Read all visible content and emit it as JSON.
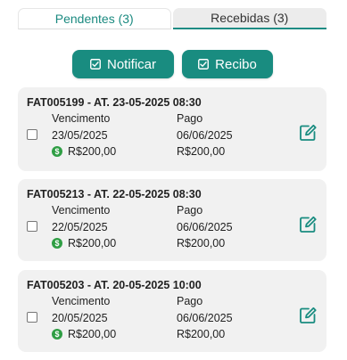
{
  "tabs": {
    "pending_label": "Pendentes (3)",
    "received_label": "Recebidas (3)"
  },
  "actions": {
    "notify_label": "Notificar",
    "receipt_label": "Recibo"
  },
  "colors": {
    "accent": "#198c80",
    "money_icon": "#2f9e44"
  },
  "invoices": [
    {
      "title": "FAT005199 - AT. 23-05-2025 08:30",
      "due_label": "Vencimento",
      "due_date": "23/05/2025",
      "paid_label": "Pago",
      "paid_date": "06/06/2025",
      "amount": "R$200,00",
      "paid_amount": "R$200,00",
      "checked": false
    },
    {
      "title": "FAT005213 - AT. 22-05-2025 08:30",
      "due_label": "Vencimento",
      "due_date": "22/05/2025",
      "paid_label": "Pago",
      "paid_date": "06/06/2025",
      "amount": "R$200,00",
      "paid_amount": "R$200,00",
      "checked": false
    },
    {
      "title": "FAT005203 - AT. 20-05-2025 10:00",
      "due_label": "Vencimento",
      "due_date": "20/05/2025",
      "paid_label": "Pago",
      "paid_date": "06/06/2025",
      "amount": "R$200,00",
      "paid_amount": "R$200,00",
      "checked": false
    }
  ],
  "icons": {
    "button_icon": "checkbox-icon",
    "amount_icon": "money-icon",
    "edit_icon": "edit-icon"
  }
}
